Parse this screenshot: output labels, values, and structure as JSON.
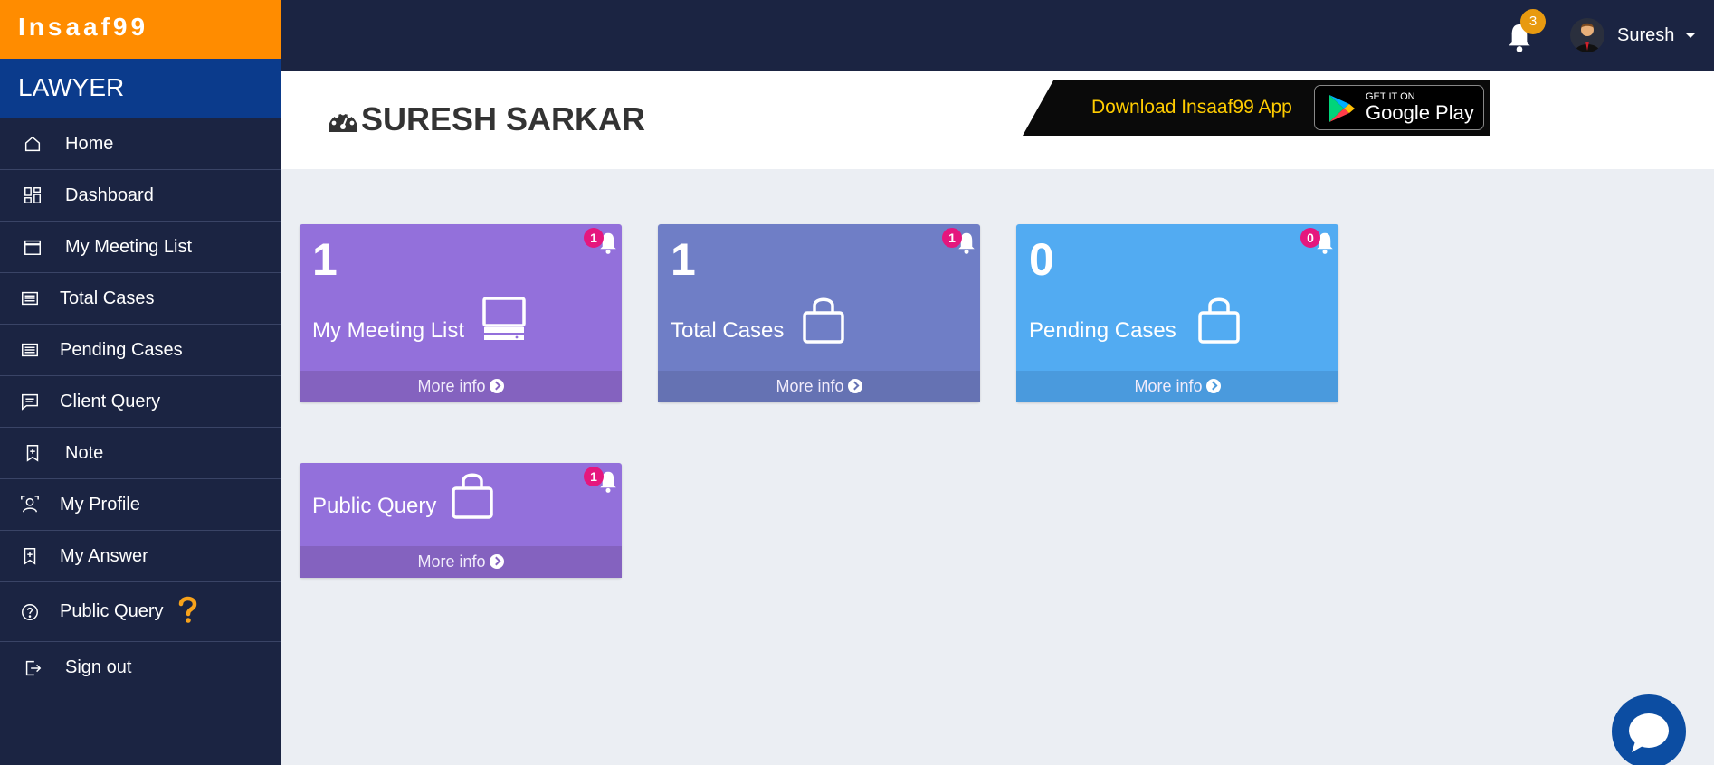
{
  "app": {
    "brand": "Insaaf99",
    "role": "LAWYER"
  },
  "sidebar": {
    "items": [
      {
        "label": "Home",
        "icon": "home-icon"
      },
      {
        "label": "Dashboard",
        "icon": "dashboard-icon"
      },
      {
        "label": "My Meeting List",
        "icon": "calendar-icon"
      },
      {
        "label": "Total Cases",
        "icon": "list-icon"
      },
      {
        "label": "Pending Cases",
        "icon": "list-icon"
      },
      {
        "label": "Client Query",
        "icon": "message-icon"
      },
      {
        "label": "Note",
        "icon": "bookmark-icon"
      },
      {
        "label": "My Profile",
        "icon": "profile-icon"
      },
      {
        "label": "My Answer",
        "icon": "bookmark-icon"
      },
      {
        "label": "Public Query",
        "icon": "help-circle-icon",
        "extra_icon": "question-mark-icon"
      },
      {
        "label": "Sign out",
        "icon": "sign-out-icon"
      }
    ]
  },
  "topbar": {
    "notification_count": "3",
    "user_name": "Suresh"
  },
  "header": {
    "title": "SURESH SARKAR",
    "promo_text": "Download Insaaf99 App",
    "store_small": "GET IT ON",
    "store_big": "Google Play"
  },
  "cards": [
    {
      "count": "1",
      "label": "My Meeting List",
      "badge": "1",
      "more": "More info",
      "icon": "desktop-icon"
    },
    {
      "count": "1",
      "label": "Total Cases",
      "badge": "1",
      "more": "More info",
      "icon": "shopping-bag-icon"
    },
    {
      "count": "0",
      "label": "Pending Cases",
      "badge": "0",
      "more": "More info",
      "icon": "shopping-bag-icon"
    },
    {
      "label": "Public Query",
      "badge": "1",
      "more": "More info",
      "icon": "shopping-bag-icon"
    }
  ],
  "colors": {
    "brand_orange": "#ff8c00",
    "sidebar_bg": "#1b2442",
    "card_purple": "#9370db",
    "card_slate": "#6f7ec6",
    "card_blue": "#52abf2",
    "badge_pink": "#e5177e",
    "promo_yellow": "#ffcc00"
  }
}
